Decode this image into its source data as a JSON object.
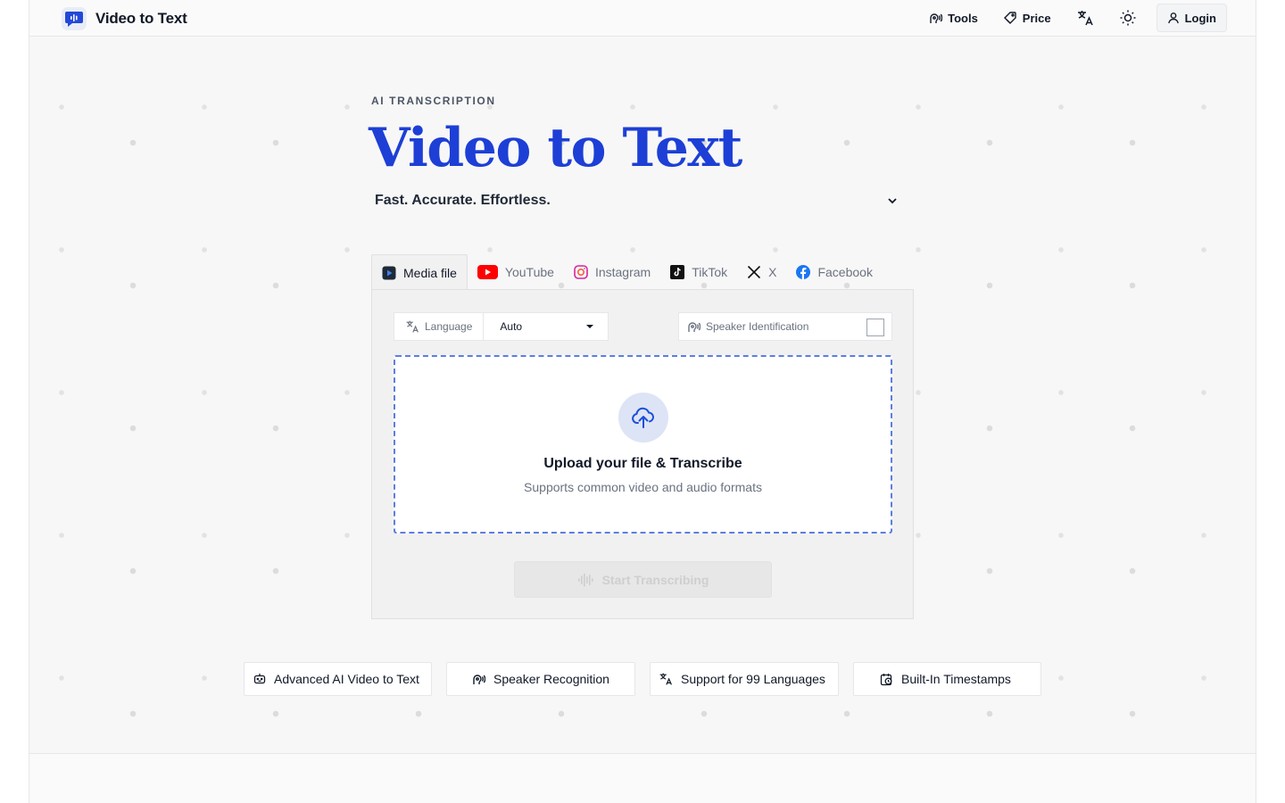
{
  "brand": {
    "name": "Video to Text",
    "logo_icon": "audio-chat-icon"
  },
  "nav": {
    "tools_label": "Tools",
    "price_label": "Price",
    "login_label": "Login"
  },
  "hero": {
    "kicker": "AI TRANSCRIPTION",
    "title": "Video to Text",
    "subtitle": "Fast. Accurate. Effortless."
  },
  "tabs": [
    {
      "label": "Media file",
      "icon": "media-file-icon",
      "active": true
    },
    {
      "label": "YouTube",
      "icon": "youtube-icon",
      "active": false
    },
    {
      "label": "Instagram",
      "icon": "instagram-icon",
      "active": false
    },
    {
      "label": "TikTok",
      "icon": "tiktok-icon",
      "active": false
    },
    {
      "label": "X",
      "icon": "x-icon",
      "active": false
    },
    {
      "label": "Facebook",
      "icon": "facebook-icon",
      "active": false
    }
  ],
  "options": {
    "language_label": "Language",
    "language_value": "Auto",
    "speaker_label": "Speaker Identification",
    "speaker_checked": false
  },
  "upload": {
    "title": "Upload your file & Transcribe",
    "subtitle": "Supports common video and audio formats"
  },
  "start_button": {
    "label": "Start Transcribing",
    "disabled": true
  },
  "features": [
    {
      "label": "Advanced AI Video to Text",
      "icon": "ai-bot-icon"
    },
    {
      "label": "Speaker Recognition",
      "icon": "speaker-icon"
    },
    {
      "label": "Support for 99 Languages",
      "icon": "translate-icon"
    },
    {
      "label": "Built-In Timestamps",
      "icon": "timestamp-icon"
    }
  ],
  "colors": {
    "accent": "#1d3fd6",
    "dropzone_border": "#5b7fe0",
    "youtube": "#ff0000",
    "facebook": "#1877f2"
  }
}
